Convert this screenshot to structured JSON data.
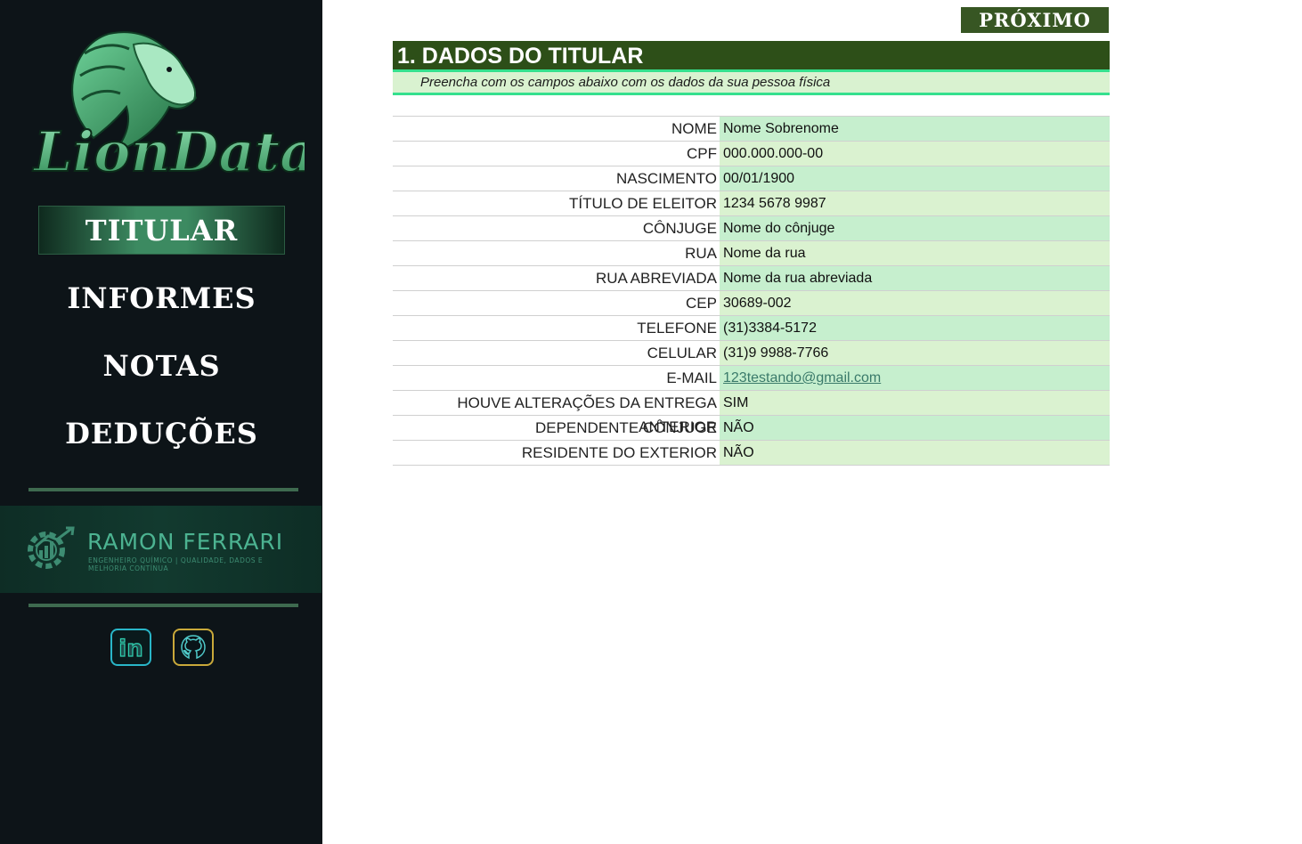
{
  "sidebar": {
    "logo_text": "LionData",
    "nav": [
      {
        "label": "TITULAR",
        "active": true
      },
      {
        "label": "INFORMES",
        "active": false
      },
      {
        "label": "NOTAS",
        "active": false
      },
      {
        "label": "DEDUÇÕES",
        "active": false
      }
    ],
    "brand": {
      "name": "RAMON FERRARI",
      "subtitle": "ENGENHEIRO QUÍMICO | QUALIDADE, DADOS E MELHORIA CONTÍNUA"
    },
    "social": [
      {
        "name": "linkedin-icon",
        "text": "in"
      },
      {
        "name": "github-icon",
        "text": ""
      }
    ]
  },
  "main": {
    "next_button": "PRÓXIMO",
    "section_title": "1. DADOS DO TITULAR",
    "section_subtitle": "Preencha com os campos abaixo com os dados da sua pessoa física",
    "fields": [
      {
        "label": "NOME",
        "value": "Nome Sobrenome"
      },
      {
        "label": "CPF",
        "value": "000.000.000-00"
      },
      {
        "label": "NASCIMENTO",
        "value": "00/01/1900"
      },
      {
        "label": "TÍTULO DE ELEITOR",
        "value": "1234 5678 9987"
      },
      {
        "label": "CÔNJUGE",
        "value": "Nome do cônjuge"
      },
      {
        "label": "RUA",
        "value": "Nome da rua"
      },
      {
        "label": "RUA ABREVIADA",
        "value": "Nome da rua abreviada"
      },
      {
        "label": "CEP",
        "value": "30689-002"
      },
      {
        "label": "TELEFONE",
        "value": "(31)3384-5172"
      },
      {
        "label": "CELULAR",
        "value": "(31)9 9988-7766"
      },
      {
        "label": "E-MAIL",
        "value": "123testando@gmail.com"
      },
      {
        "label": "HOUVE ALTERAÇÕES DA ENTREGA ANTERIOR",
        "value": "SIM"
      },
      {
        "label": "DEPENDENTE CÔNJUGE",
        "value": "NÃO"
      },
      {
        "label": "RESIDENTE DO EXTERIOR",
        "value": "NÃO"
      }
    ]
  },
  "colors": {
    "sidebar_bg": "#0d1418",
    "header_bg": "#2d4f18",
    "accent": "#35e08e",
    "field_bg_a": "#c6efce",
    "field_bg_b": "#daf2d0",
    "button_bg": "#375623"
  }
}
